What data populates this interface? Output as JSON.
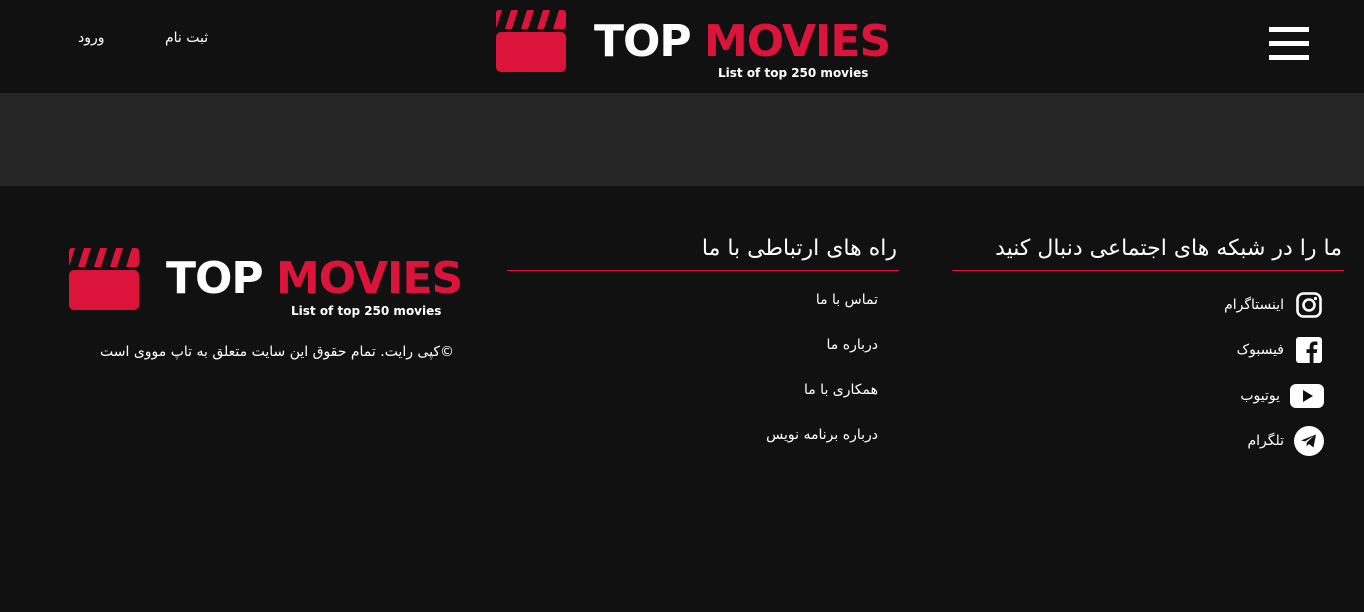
{
  "header": {
    "login_label": "ورود",
    "register_label": "ثبت نام",
    "logo": {
      "word1": "TOP",
      "word2": "MOVIES",
      "tagline": "List of top 250 movies"
    }
  },
  "colors": {
    "accent": "#dc143c",
    "background": "#121112",
    "band": "#262626"
  },
  "footer": {
    "social": {
      "title": "ما را در شبکه های اجتماعی دنبال کنید",
      "items": [
        {
          "label": "اینستاگرام",
          "icon": "instagram-icon"
        },
        {
          "label": "فیسبوک",
          "icon": "facebook-icon"
        },
        {
          "label": "یوتیوب",
          "icon": "youtube-icon"
        },
        {
          "label": "تلگرام",
          "icon": "telegram-icon"
        }
      ]
    },
    "contact": {
      "title": "راه های ارتباطی با ما",
      "items": [
        {
          "label": "تماس با ما"
        },
        {
          "label": "درباره ما"
        },
        {
          "label": "همکاری با ما"
        },
        {
          "label": "درباره برنامه نویس"
        }
      ]
    },
    "brand": {
      "logo": {
        "word1": "TOP",
        "word2": "MOVIES",
        "tagline": "List of top 250 movies"
      },
      "copyright": "©کپی رایت. تمام حقوق این سایت متعلق به تاپ مووی است"
    }
  }
}
